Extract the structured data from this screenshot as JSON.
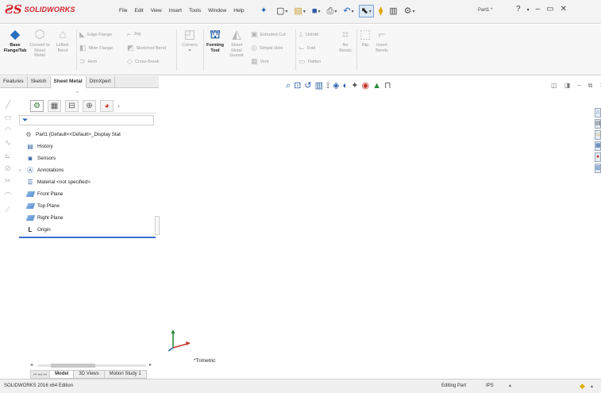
{
  "app": {
    "logo_mark": "ƧS",
    "logo_text": "SOLIDWORKS",
    "document_name": "Part1 *"
  },
  "menu": [
    "File",
    "Edit",
    "View",
    "Insert",
    "Tools",
    "Window",
    "Help"
  ],
  "quick_access": [
    {
      "icon": "new-document-icon",
      "glyph": "▢"
    },
    {
      "icon": "open-folder-icon",
      "glyph": "📂"
    },
    {
      "icon": "save-icon",
      "glyph": "💾"
    },
    {
      "icon": "print-icon",
      "glyph": "🖶"
    },
    {
      "icon": "undo-icon",
      "glyph": "↶"
    },
    {
      "icon": "select-arrow-icon",
      "glyph": "⬉"
    }
  ],
  "help": {
    "label": "?"
  },
  "ribbon": {
    "base_flange": "Base Flange/Tab",
    "convert": "Convert to Sheet Metal",
    "lofted_bend": "Lofted-Bend",
    "edge_flange": "Edge Flange",
    "jog": "Jog",
    "miter_flange": "Miter Flange",
    "sketched_bend": "Sketched Bend",
    "hem": "Hem",
    "cross_break": "Cross-Break",
    "corners": "Corners",
    "forming_tool": "Forming Tool",
    "sheet_metal_gusset": "Sheet Metal Gusset",
    "extruded_cut": "Extruded Cut",
    "simple_hole": "Simple Hole",
    "vent": "Vent",
    "unfold": "Unfold",
    "fold": "Fold",
    "flatten": "Flatten",
    "no_bends": "No Bends",
    "rip": "Rip",
    "insert_bends": "Insert Bends"
  },
  "fm_tabs": [
    "Features",
    "Sketch",
    "Sheet Metal",
    "DimXpert"
  ],
  "fm_active_tab": "Sheet Metal",
  "tree": [
    {
      "label": "Part1  (Default<<Default>_Display Stat",
      "icon": "part-icon",
      "expand": ""
    },
    {
      "label": "History",
      "icon": "history-icon",
      "expand": ""
    },
    {
      "label": "Sensors",
      "icon": "sensors-icon",
      "expand": ""
    },
    {
      "label": "Annotations",
      "icon": "annotations-icon",
      "expand": "›"
    },
    {
      "label": "Material <not specified>",
      "icon": "material-icon",
      "expand": ""
    },
    {
      "label": "Front Plane",
      "icon": "plane-icon",
      "expand": ""
    },
    {
      "label": "Top Plane",
      "icon": "plane-icon",
      "expand": ""
    },
    {
      "label": "Right Plane",
      "icon": "plane-icon",
      "expand": ""
    },
    {
      "label": "Origin",
      "icon": "origin-icon",
      "expand": ""
    }
  ],
  "view": {
    "orientation_label": "*Trimetric"
  },
  "bottom_tabs": [
    "Model",
    "3D Views",
    "Motion Study 1"
  ],
  "bottom_active_tab": "Model",
  "status": {
    "edition": "SOLIDWORKS 2016 x64 Edition",
    "mode": "Editing Part",
    "units": "IPS"
  },
  "colors": {
    "brand": "#d2232a",
    "selection_line": "#3b6fd1"
  }
}
